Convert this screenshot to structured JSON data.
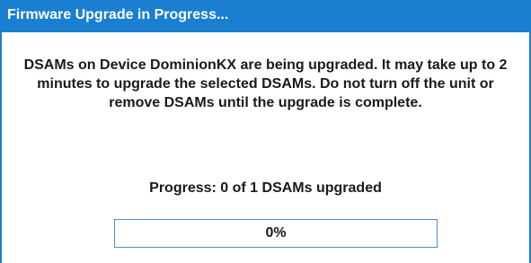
{
  "dialog": {
    "title": "Firmware Upgrade in Progress...",
    "message": "DSAMs on Device DominionKX are being upgraded. It may take up to 2 minutes to upgrade the selected DSAMs. Do not turn off the unit or remove DSAMs until the upgrade is complete.",
    "progress_text": "Progress: 0 of 1 DSAMs upgraded",
    "progress_percent_label": "0%",
    "progress_value": 0
  },
  "colors": {
    "accent": "#1a7fd0",
    "progress_border": "#4a90d9",
    "text": "#1a1a1a"
  }
}
